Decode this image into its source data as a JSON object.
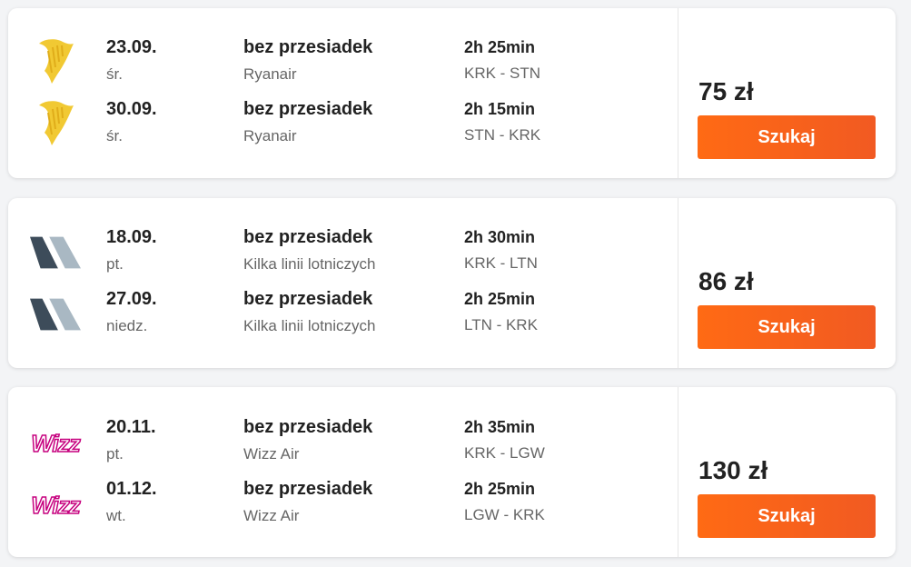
{
  "offers": [
    {
      "price": "75 zł",
      "button": "Szukaj",
      "legs": [
        {
          "logo": "ryanair-harp-logo",
          "date": "23.09.",
          "dow": "śr.",
          "stops": "bez przesiadek",
          "airline": "Ryanair",
          "duration": "2h 25min",
          "route": "KRK - STN"
        },
        {
          "logo": "ryanair-harp-logo",
          "date": "30.09.",
          "dow": "śr.",
          "stops": "bez przesiadek",
          "airline": "Ryanair",
          "duration": "2h 15min",
          "route": "STN - KRK"
        }
      ]
    },
    {
      "price": "86 zł",
      "button": "Szukaj",
      "legs": [
        {
          "logo": "multi-airline-tail-logo",
          "date": "18.09.",
          "dow": "pt.",
          "stops": "bez przesiadek",
          "airline": "Kilka linii lotniczych",
          "duration": "2h 30min",
          "route": "KRK - LTN"
        },
        {
          "logo": "multi-airline-tail-logo",
          "date": "27.09.",
          "dow": "niedz.",
          "stops": "bez przesiadek",
          "airline": "Kilka linii lotniczych",
          "duration": "2h 25min",
          "route": "LTN - KRK"
        }
      ]
    },
    {
      "price": "130 zł",
      "button": "Szukaj",
      "legs": [
        {
          "logo": "wizz-air-logo",
          "logo_text": "Wizz",
          "date": "20.11.",
          "dow": "pt.",
          "stops": "bez przesiadek",
          "airline": "Wizz Air",
          "duration": "2h 35min",
          "route": "KRK - LGW"
        },
        {
          "logo": "wizz-air-logo",
          "logo_text": "Wizz",
          "date": "01.12.",
          "dow": "wt.",
          "stops": "bez przesiadek",
          "airline": "Wizz Air",
          "duration": "2h 25min",
          "route": "LGW - KRK"
        }
      ]
    }
  ],
  "colors": {
    "button": "#f15a22",
    "ryanair": "#f1c933",
    "tail_dark": "#3d4c5a",
    "tail_light": "#a9b8c3",
    "wizz": "#c6007e"
  }
}
